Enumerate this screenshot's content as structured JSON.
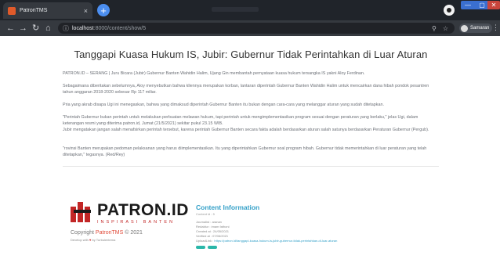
{
  "browser": {
    "tab_title": "PatronTMS",
    "tab_close": "×",
    "new_tab": "+",
    "url_host": "localhost",
    "url_path": ":8000/content/show/5",
    "profile_name": "Samaran",
    "window_controls": {
      "minimize": "—",
      "maximize": "▢",
      "close": "✕"
    },
    "icons": [
      "back-arrow-icon",
      "forward-arrow-icon",
      "reload-icon",
      "home-icon",
      "info-icon",
      "zoom-icon",
      "star-icon",
      "kebab-menu-icon"
    ]
  },
  "article": {
    "title": "Tanggapi Kuasa Hukum IS, Jubir: Gubernur Tidak Perintahkan di Luar Aturan",
    "paragraphs": [
      "PATRON.ID – SERANG | Juru Bicara (Jubir) Gubernur Banten Wahidin Halim, Ujang Gin membantah pernyataan kuasa hukum tersangka IS yakni Aloy Ferdinan.",
      "Sebagaimana diberitakan sebelumnya, Aloy menyebutkan bahwa kliennya merupakan korban, lantaran diperintah Gubernur Banten Wahidin Halim untuk mencairkan dana hibah pondok pesantren tahun anggaran 2018-2020 sebesar Rp 117 miliar.",
      "Pria yang akrab disapa Ugi ini menegaskan, bahwa yang dimaksud diperintah Gubernur Banten itu bukan dengan cara-cara yang melanggar aturan yang sudah ditetapkan.",
      "\"Perintah Gubernur bukan perintah untuk melakukan perbuatan melawan hukum, tapi perintah untuk mengimplementasikan program sesuai dengan peraturan yang berlaku,\" jelas Ugi, dalam keterangan resmi yang diterima patron.id, Jumat (21/5/2021) sekitar pukul 23.15 WIB.\nJubir mengatakan jangan salah menafsirkan perintah tersebut, karena perintah Gubernur Banten secara fakta adalah berdasarkan aturan salah satunya berdasarkan Peraturan Gubernur (Pergub).",
      "\"rovinsi Banten merupakan pedoman pelaksanan yang harus diimplementasikan. Itu yang diperintahkan Gubernur soal program hibah. Gubernur tidak memerintahkan di luar peraturan yang telah ditetapkan,\" tegasnya. (Red/Rey)"
    ]
  },
  "footer": {
    "logo_name": "PATRON.ID",
    "logo_tagline": "INSPIRASI BANTEN",
    "copyright_prefix": "Copyright ",
    "copyright_brand": "PatronTMS",
    "copyright_suffix": " © 2021",
    "developed_prefix": "Develop with ",
    "developed_heart": "♥",
    "developed_suffix": " by Turbulentema"
  },
  "content_info": {
    "title": "Content Information",
    "content_id": "Content id : 5",
    "journalist": "Journalist : aranan",
    "editor": "Redaktur : imam fathoni",
    "created_at": "Created at : 24/05/2021",
    "verified_at": "Verified at : 07/06/2021",
    "url_label": "UploadLink : ",
    "url_value": "https://patron.id/tanggapi-kuasa-hukum-is-jubir-gubernur-tidak-perintahkan-di-luar-aturan"
  },
  "colors": {
    "accent": "#34a0c8",
    "brand_red": "#c22626",
    "tag": "#2ab7a9"
  }
}
